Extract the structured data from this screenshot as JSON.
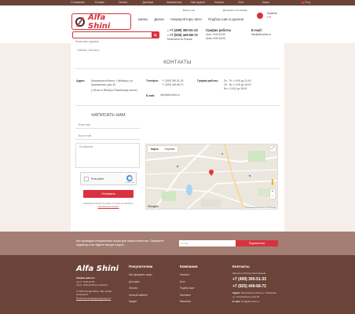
{
  "topnav": {
    "items": [
      "О компании",
      "Условия",
      "Оплата",
      "Доставка",
      "Шиномонтаж",
      "Наш журнал",
      "Новости",
      "Блог",
      "Акции"
    ],
    "login": "Вход",
    "contacts_label": "Контакты"
  },
  "header_links": {
    "sell_tires": "Выкуп шин",
    "b2b": "Дилерам и оптовикам"
  },
  "logo_text": "Alfa Shini",
  "mainnav": [
    "Шины",
    "Диски",
    "Аккумуляторы авто",
    "Подбор шин и дисков"
  ],
  "search": {
    "placeholder": "Поиск шин и дисков"
  },
  "header_phones": {
    "phone1": "+7 (499) 390-51-33",
    "phone2": "+7 (925) 449-68-72",
    "note": "Бесплатно по России"
  },
  "header_hours": {
    "title": "График работы",
    "line1": "пн-пт: 9:00-21:00",
    "line2": "сб-вс: 9:00-18:00"
  },
  "header_email": {
    "title": "E-mail:",
    "value": "info@alfa-shini.ru"
  },
  "cart": {
    "label": "Корзина",
    "count": "0 ₽"
  },
  "breadcrumb": "Главная / Контакты",
  "page_title": "КОНТАКТЫ",
  "contacts": {
    "address_label": "Адрес:",
    "address_value": "Московская область, г.Люберцы, ул. Кузьминская, дом 16",
    "address_note": "(≈35 км от МКАД по Рязанскому шоссе)",
    "phone_label": "Телефон:",
    "phone_values": [
      "+7 (499) 390-51-33",
      "+7 (925) 449-68-72"
    ],
    "hours_label": "График работы:",
    "hours_values": [
      "Пн - Пт: с 9:00 до 21:00",
      "Сб - Вс: с 9:00 до 18:00",
      "Вс: с 10:00 до 18:00"
    ],
    "email_label": "E-mail:",
    "email_value": "info@alfa-shini.ru"
  },
  "form": {
    "title": "НАПИСАТЬ НАМ",
    "name_placeholder": "Ваше имя",
    "phone_placeholder": "Ваш e-mail",
    "message_placeholder": "Сообщение",
    "captcha_text": "Я не робот",
    "captcha_small": "reCAPTCHA",
    "submit": "Отправить",
    "agree_text": "Нажимая на кнопку, вы даёте согласие на обработку",
    "agree_link": "персональных данных"
  },
  "map": {
    "tab_map": "Карта",
    "tab_satellite": "Спутник",
    "google": "Google",
    "attribution": "Картографические данные © 2023 Google"
  },
  "subscribe": {
    "text": "Мы проводим специальные акции для наших клиентов. Оформите подписку и вы будете всегда в курсе.",
    "input_placeholder": "E-mail",
    "button": "Подписаться"
  },
  "footer": {
    "logo": "Alfa Shini",
    "hours_title": "График работы:",
    "hours_lines": [
      "пн-пт: 9:00-21:00",
      "сб-вс: 9:00-18:00 (по записи)"
    ],
    "copyright": "© 2023 Альфа Шины. Все права защищены.",
    "policy": "Политика конфиденциальности",
    "col1_title": "Покупателям",
    "col1_items": [
      "Как оформить заказ",
      "Доставка",
      "Оплата",
      "Личный кабинет",
      "Кредит"
    ],
    "col2_title": "Компания",
    "col2_items": [
      "Новости",
      "Блог",
      "Подбор шин",
      "Контакты",
      "Вакансии"
    ],
    "col3_title": "Контакты",
    "col3_note": "Звонок по России бесплатный",
    "col3_phone1": "+7 (499) 390-51-33",
    "col3_phone2": "+7 (925) 449-68-72",
    "col3_address_label": "Адрес:",
    "col3_address": "Московская область, г.Люберцы, ул. Кузьминская, дом 16",
    "col3_email_label": "E-mail:",
    "col3_email": "info@alfa-shini.ru"
  },
  "colors": {
    "brown": "#6b4338",
    "accent": "#d8323f",
    "beige": "#f5eeea",
    "tan": "#a47e72"
  }
}
